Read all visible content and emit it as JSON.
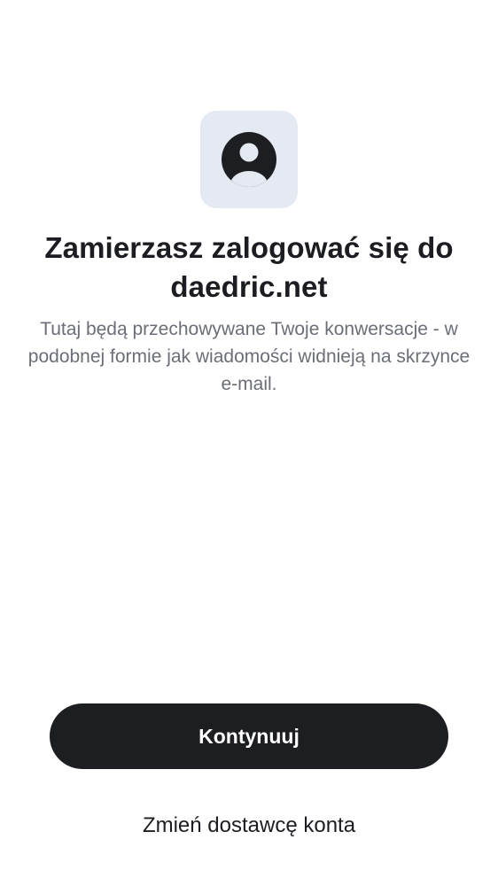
{
  "colors": {
    "background": "#ffffff",
    "tile_background": "#e5e9f2",
    "primary_button": "#1d1e22",
    "primary_button_text": "#ffffff",
    "title_text": "#1c1d22",
    "subtitle_text": "#6b6e77"
  },
  "header": {
    "icon": "account-circle-icon",
    "title": "Zamierzasz zalogować się do daedric.net",
    "subtitle": "Tutaj będą przechowywane Twoje konwersacje - w podobnej formie jak wiadomości widnieją na skrzynce e-mail."
  },
  "actions": {
    "continue_label": "Kontynuuj",
    "change_provider_label": "Zmień dostawcę konta"
  }
}
